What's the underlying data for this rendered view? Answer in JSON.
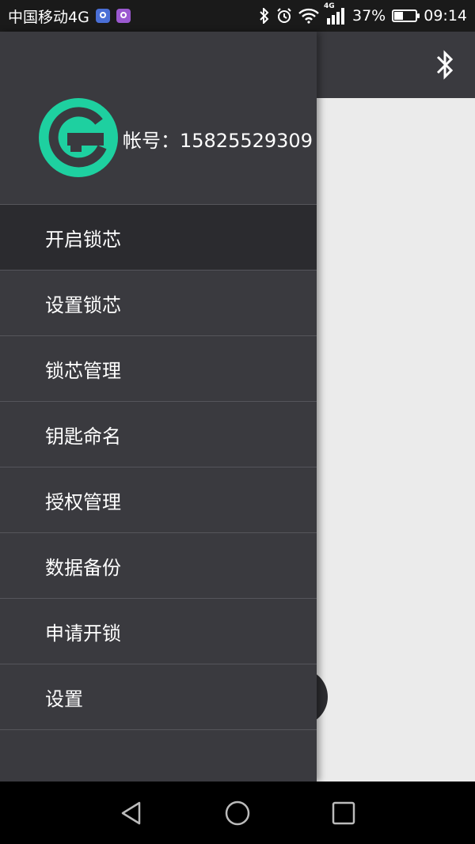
{
  "status_bar": {
    "carrier": "中国移动4G",
    "network_badge": "4G",
    "battery": "37%",
    "battery_level": 0.37,
    "time": "09:14",
    "icons": [
      "location-app-icon",
      "gallery-app-icon",
      "bluetooth-icon",
      "alarm-icon",
      "wifi-icon",
      "signal-icon",
      "battery-icon"
    ]
  },
  "app_bar": {
    "right_icon": "bluetooth-icon"
  },
  "drawer": {
    "account_label": "帐号：15825529309",
    "menu": [
      {
        "label": "开启锁芯",
        "active": true
      },
      {
        "label": "设置锁芯"
      },
      {
        "label": "锁芯管理"
      },
      {
        "label": "钥匙命名"
      },
      {
        "label": "授权管理"
      },
      {
        "label": "数据备份"
      },
      {
        "label": "申请开锁"
      },
      {
        "label": "设置"
      }
    ]
  },
  "nav_bar": {
    "buttons": [
      "back-icon",
      "home-icon",
      "recents-icon"
    ]
  },
  "colors": {
    "drawer_bg": "#3a3a3f",
    "active_item_bg": "#2b2b2f",
    "logo": "#1ed0a0",
    "content_bg": "#ebebeb"
  }
}
